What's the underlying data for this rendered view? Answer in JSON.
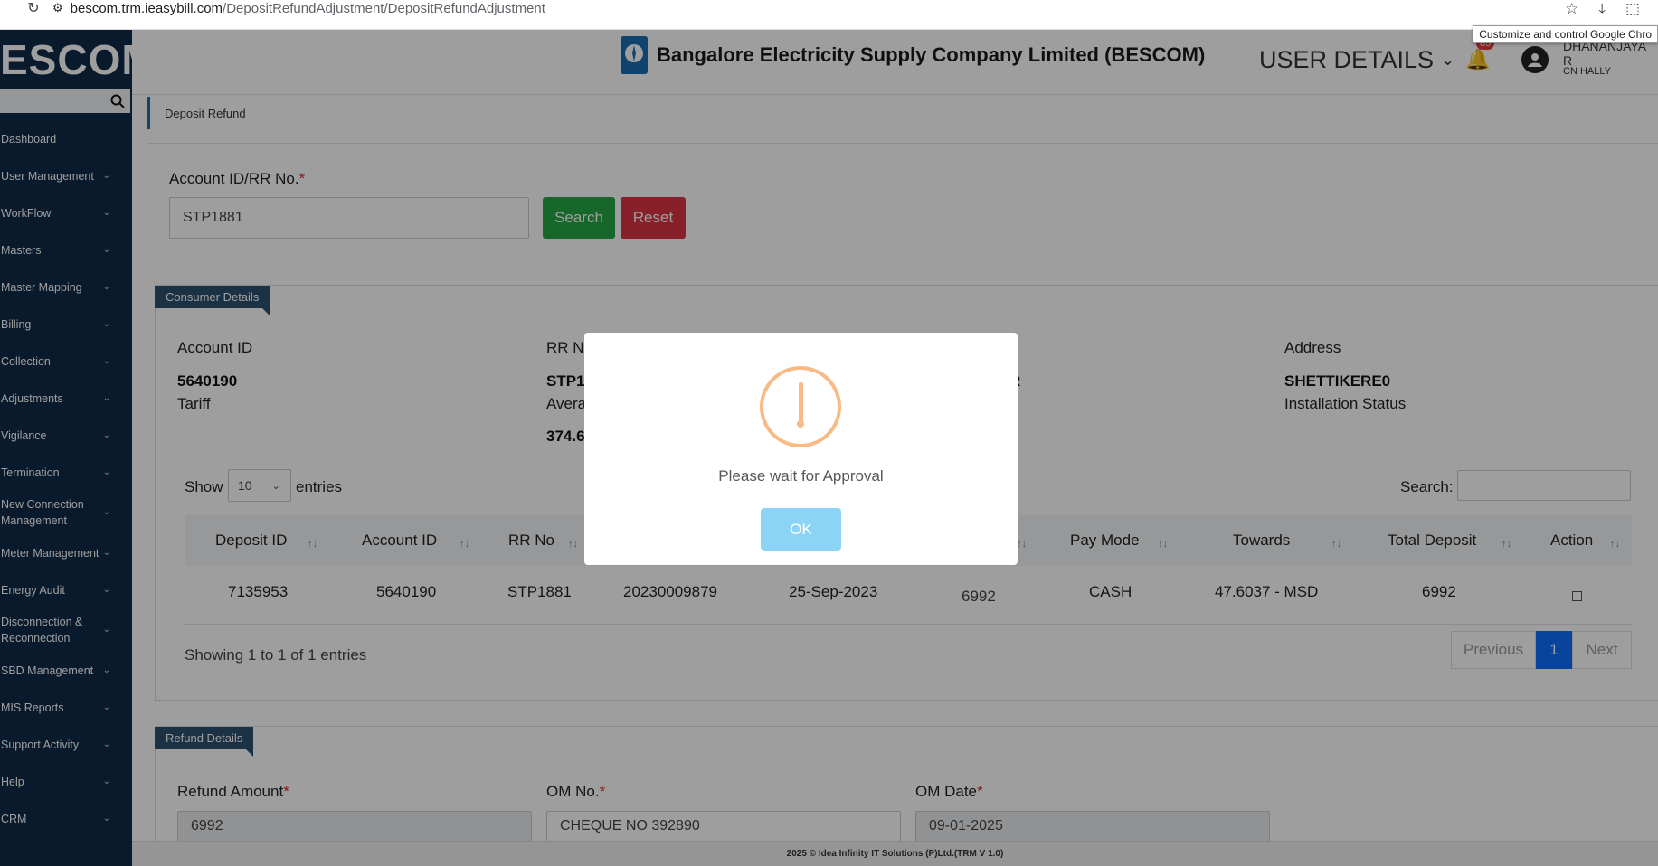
{
  "browser": {
    "url_host": "bescom.trm.ieasybill.com",
    "url_path": "/DepositRefundAdjustment/DepositRefundAdjustment",
    "tooltip": "Customize and control Google Chro"
  },
  "sidebar": {
    "logo": "ESCOM",
    "items": [
      {
        "label": "Dashboard"
      },
      {
        "label": "User Management"
      },
      {
        "label": "WorkFlow"
      },
      {
        "label": "Masters"
      },
      {
        "label": "Master Mapping"
      },
      {
        "label": "Billing"
      },
      {
        "label": "Collection"
      },
      {
        "label": "Adjustments"
      },
      {
        "label": "Vigilance"
      },
      {
        "label": "Termination"
      },
      {
        "label": "New Connection Management"
      },
      {
        "label": "Meter Management"
      },
      {
        "label": "Energy Audit"
      },
      {
        "label": "Disconnection & Reconnection"
      },
      {
        "label": "SBD Management"
      },
      {
        "label": "MIS Reports"
      },
      {
        "label": "Support Activity"
      },
      {
        "label": "Help"
      },
      {
        "label": "CRM"
      }
    ]
  },
  "header": {
    "company": "Bangalore Electricity Supply Company Limited (BESCOM)",
    "user_details": "USER DETAILS",
    "notif_count": "85",
    "user_name": "DHANANJAYA R",
    "user_location": "CN HALLY"
  },
  "breadcrumb": "Deposit Refund",
  "search_form": {
    "label": "Account ID/RR No.",
    "required": "*",
    "value": "STP1881",
    "search_label": "Search",
    "reset_label": "Reset"
  },
  "consumer": {
    "tag": "Consumer Details",
    "account_id_label": "Account ID",
    "account_id": "5640190",
    "tariff_label": "Tariff",
    "rr_label": "RR N",
    "rr_value": "STP1",
    "avg_label": "Avera",
    "avg_value": "374.6",
    "name_fragment": "R",
    "address_label": "Address",
    "address": "SHETTIKERE0",
    "install_label": "Installation Status"
  },
  "table": {
    "show": "Show",
    "entries_value": "10",
    "entries": "entries",
    "search_label": "Search:",
    "headers": [
      "Deposit ID",
      "Account ID",
      "RR No",
      "Pay Mode",
      "Towards",
      "Total Deposit",
      "Action"
    ],
    "row": [
      "7135953",
      "5640190",
      "STP1881",
      "20230009879",
      "25-Sep-2023",
      "6992",
      "CASH",
      "47.6037 - MSD",
      "6992"
    ],
    "info": "Showing 1 to 1 of 1 entries",
    "prev": "Previous",
    "page": "1",
    "next": "Next"
  },
  "refund": {
    "tag": "Refund Details",
    "amount_label": "Refund Amount",
    "amount": "6992",
    "om_no_label": "OM No.",
    "om_no": "CHEQUE NO 392890",
    "om_date_label": "OM Date",
    "om_date": "09-01-2025"
  },
  "footer": "2025 © Idea Infinity IT Solutions (P)Ltd.(TRM V 1.0)",
  "modal": {
    "message": "Please wait for Approval",
    "ok_label": "OK"
  }
}
